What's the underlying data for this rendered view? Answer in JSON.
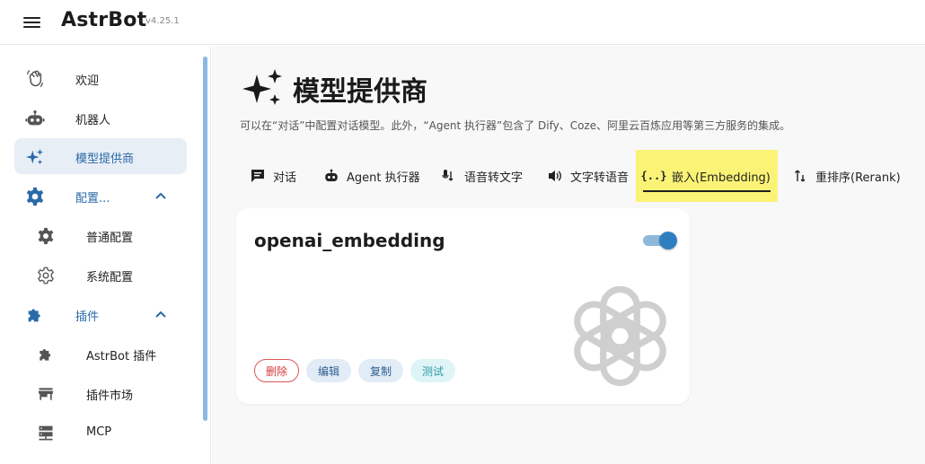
{
  "app": {
    "title": "AstrBot",
    "version": "v4.25.1"
  },
  "sidebar": {
    "items": [
      {
        "label": "欢迎",
        "icon": "wave-hand-icon"
      },
      {
        "label": "机器人",
        "icon": "robot-icon"
      },
      {
        "label": "模型提供商",
        "icon": "sparkle-icon",
        "active": true
      },
      {
        "label": "配置...",
        "icon": "gear-icon",
        "expanded": true
      },
      {
        "label": "普通配置",
        "icon": "gear-icon",
        "sub": true
      },
      {
        "label": "系统配置",
        "icon": "gear-outline-icon",
        "sub": true
      },
      {
        "label": "插件",
        "icon": "puzzle-icon",
        "expanded": true
      },
      {
        "label": "AstrBot 插件",
        "icon": "puzzle-icon",
        "sub": true
      },
      {
        "label": "插件市场",
        "icon": "store-icon",
        "sub": true
      },
      {
        "label": "MCP",
        "icon": "server-icon",
        "sub": true
      }
    ]
  },
  "page": {
    "title": "模型提供商",
    "description": "可以在“对话”中配置对话模型。此外，“Agent 执行器”包含了 Dify、Coze、阿里云百炼应用等第三方服务的集成。"
  },
  "tabs": [
    {
      "label": "对话",
      "icon": "chat-icon"
    },
    {
      "label": "Agent 执行器",
      "icon": "robot-icon"
    },
    {
      "label": "语音转文字",
      "icon": "speech-to-text-icon"
    },
    {
      "label": "文字转语音",
      "icon": "speaker-icon"
    },
    {
      "label": "嵌入(Embedding)",
      "icon": "braces-icon",
      "active": true
    },
    {
      "label": "重排序(Rerank)",
      "icon": "sort-arrows-icon"
    }
  ],
  "provider_card": {
    "name": "openai_embedding",
    "enabled": true,
    "logo": "openai-logo",
    "actions": {
      "delete": "删除",
      "edit": "编辑",
      "copy": "复制",
      "test": "测试"
    }
  },
  "colors": {
    "accent": "#2f7fc0",
    "active_tab_highlight": "#fbf376",
    "sidebar_active_bg": "#e8eef6",
    "delete_red": "#d83c3c",
    "scrollbar": "#8cb8e6"
  }
}
